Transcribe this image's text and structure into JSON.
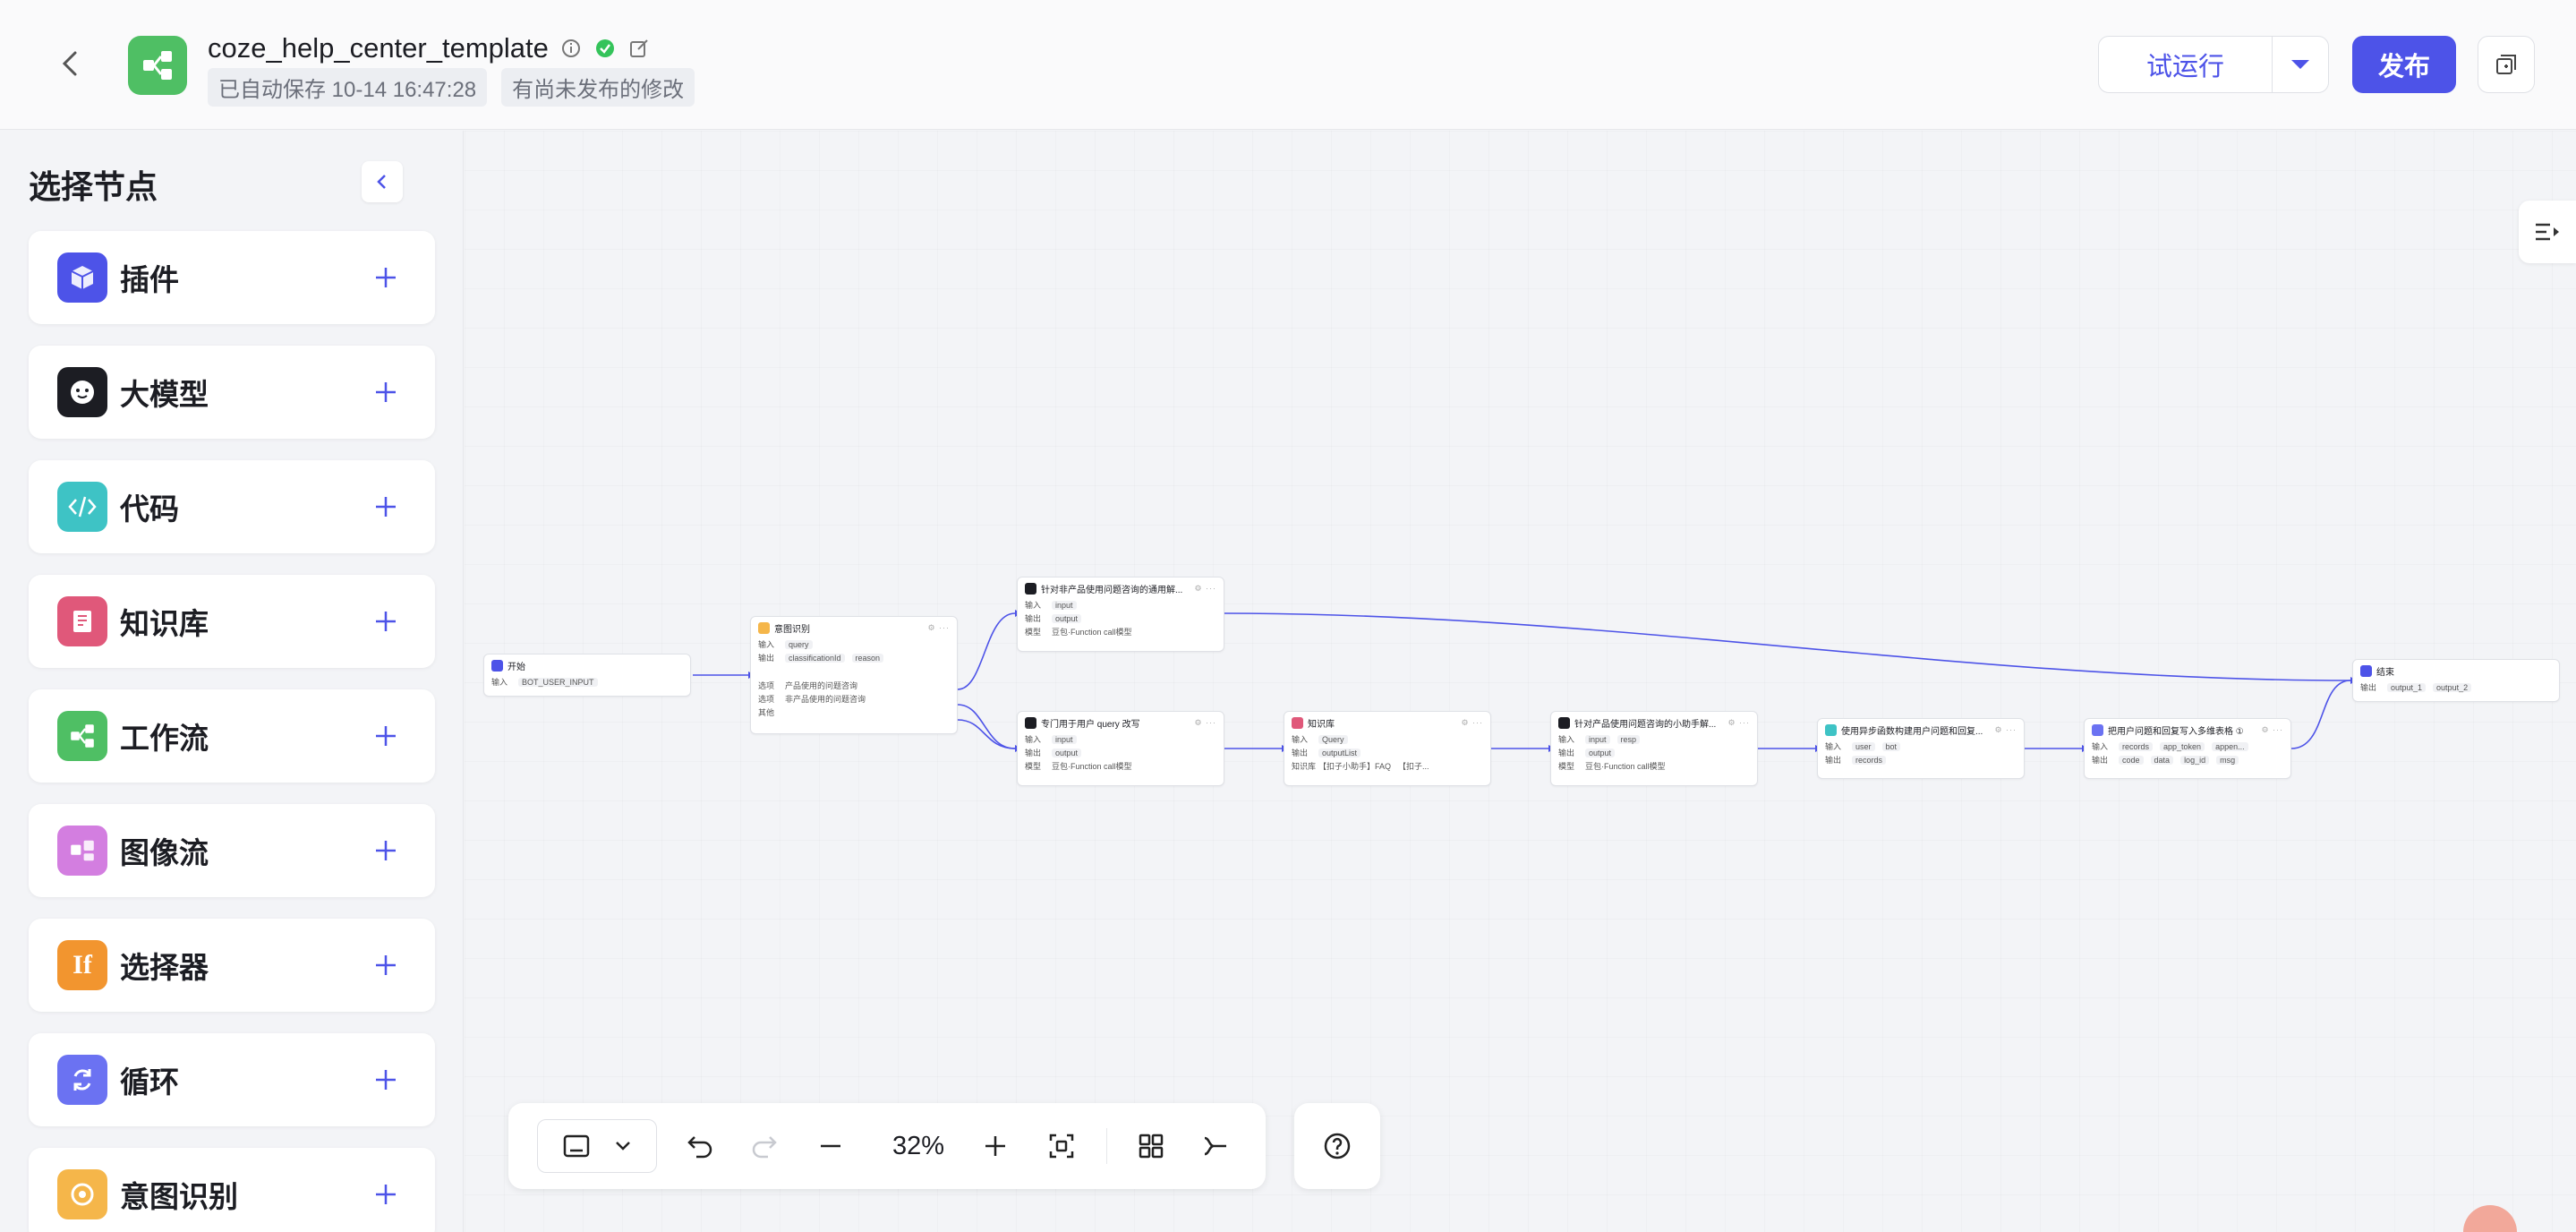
{
  "header": {
    "title": "coze_help_center_template",
    "autosave": "已自动保存 10-14 16:47:28",
    "unpublished": "有尚未发布的修改",
    "run_label": "试运行",
    "publish_label": "发布"
  },
  "sidebar": {
    "title": "选择节点",
    "items": [
      {
        "label": "插件",
        "icon": "plugin-icon",
        "color": "#4d53e8"
      },
      {
        "label": "大模型",
        "icon": "llm-icon",
        "color": "#1c1d23"
      },
      {
        "label": "代码",
        "icon": "code-icon",
        "color": "#3ec3c5"
      },
      {
        "label": "知识库",
        "icon": "knowledge-icon",
        "color": "#e0587a"
      },
      {
        "label": "工作流",
        "icon": "workflow-icon",
        "color": "#4fbf64"
      },
      {
        "label": "图像流",
        "icon": "imageflow-icon",
        "color": "#d37ee0"
      },
      {
        "label": "选择器",
        "icon": "condition-icon",
        "color": "#f2952f"
      },
      {
        "label": "循环",
        "icon": "loop-icon",
        "color": "#6b72f2"
      },
      {
        "label": "意图识别",
        "icon": "intent-icon",
        "color": "#f5b64a"
      }
    ]
  },
  "canvas": {
    "nodes": {
      "start": {
        "title": "开始",
        "in_label": "输入",
        "in_val": "BOT_USER_INPUT"
      },
      "intent": {
        "title": "意图识别",
        "in_label": "输入",
        "in_val": "query",
        "out_label": "输出",
        "out_v1": "classificationId",
        "out_v2": "reason",
        "opt_label": "选项",
        "opt1": "产品使用的问题咨询",
        "opt2": "非产品使用的问题咨询",
        "other": "其他"
      },
      "llm1": {
        "title": "针对非产品使用问题咨询的通用解...",
        "in_label": "输入",
        "in_val": "input",
        "out_label": "输出",
        "out_val": "output",
        "model_label": "模型",
        "model_val": "豆包·Function call模型"
      },
      "llm2": {
        "title": "专门用于用户 query 改写",
        "in_label": "输入",
        "in_val": "input",
        "out_label": "输出",
        "out_val": "output",
        "model_label": "模型",
        "model_val": "豆包·Function call模型"
      },
      "kb": {
        "title": "知识库",
        "in_label": "输入",
        "in_val": "Query",
        "out_label": "输出",
        "out_val": "outputList",
        "kb_label": "知识库",
        "kb1": "【扣子小助手】FAQ",
        "kb2": "【扣子..."
      },
      "llm3": {
        "title": "针对产品使用问题咨询的小助手解...",
        "in_label": "输入",
        "in_val": "input",
        "in_val2": "resp",
        "out_label": "输出",
        "out_val": "output",
        "model_label": "模型",
        "model_val": "豆包·Function call模型"
      },
      "code": {
        "title": "使用异步函数构建用户问题和回复...",
        "in_label": "输入",
        "in_val": "user",
        "in_val2": "bot",
        "out_label": "输出",
        "out_val": "records"
      },
      "plugin": {
        "title": "把用户问题和回复写入多维表格 ①",
        "in_label": "输入",
        "in_val": "records",
        "in_val2": "app_token",
        "in_val3": "appen...",
        "out_label": "输出",
        "out_val": "code",
        "out_val2": "data",
        "out_val3": "log_id",
        "out_val4": "msg"
      },
      "end": {
        "title": "结束",
        "out_label": "输出",
        "out_val": "output_1",
        "out_val2": "output_2"
      }
    }
  },
  "toolbar": {
    "zoom": "32%"
  }
}
